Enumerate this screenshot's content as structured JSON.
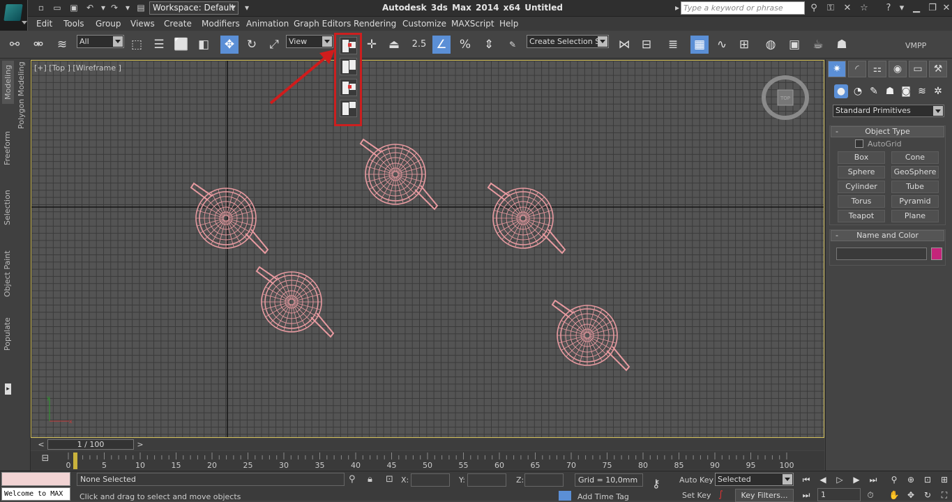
{
  "title_bar": {
    "app_title": "Autodesk 3ds Max  2014 x64     Untitled",
    "workspace": "Workspace: Default",
    "search_placeholder": "Type a keyword or phrase"
  },
  "menu": [
    "Edit",
    "Tools",
    "Group",
    "Views",
    "Create",
    "Modifiers",
    "Animation",
    "Graph Editors",
    "Rendering",
    "Customize",
    "MAXScript",
    "Help"
  ],
  "toolbar": {
    "selection_filter": "All",
    "ref_coord": "View",
    "snap_value": "2.5",
    "named_selection": "Create Selection Se",
    "vmpp": "VMPP"
  },
  "ribbon_tabs": [
    "Modeling",
    "Polygon Modeling",
    "Freeform",
    "Selection",
    "Object Paint",
    "Populate"
  ],
  "viewport": {
    "label": "[+] [Top ] [Wireframe ]",
    "navcube_label": "TOP",
    "wire_color": "#e89aa0",
    "highlight_color": "#cc1f1f"
  },
  "command_panel": {
    "category": "Standard Primitives",
    "object_type_title": "Object Type",
    "autogrid_label": "AutoGrid",
    "buttons": [
      "Box",
      "Cone",
      "Sphere",
      "GeoSphere",
      "Cylinder",
      "Tube",
      "Torus",
      "Pyramid",
      "Teapot",
      "Plane"
    ],
    "name_color_title": "Name and Color",
    "object_color": "#c4247a"
  },
  "timeline": {
    "frame_display": "1 / 100",
    "ticks": [
      "0",
      "5",
      "10",
      "15",
      "20",
      "25",
      "30",
      "35",
      "40",
      "45",
      "50",
      "55",
      "60",
      "65",
      "70",
      "75",
      "80",
      "85",
      "90",
      "95",
      "100"
    ]
  },
  "status": {
    "listener_text": "Welcome to MAX",
    "selection": "None Selected",
    "prompt": "Click and drag to select and move objects",
    "x_label": "X:",
    "y_label": "Y:",
    "z_label": "Z:",
    "grid": "Grid = 10,0mm",
    "add_time_tag": "Add Time Tag",
    "auto_key": "Auto Key",
    "set_key": "Set Key",
    "key_mode": "Selected",
    "key_filters": "Key Filters...",
    "current_frame": "1"
  }
}
